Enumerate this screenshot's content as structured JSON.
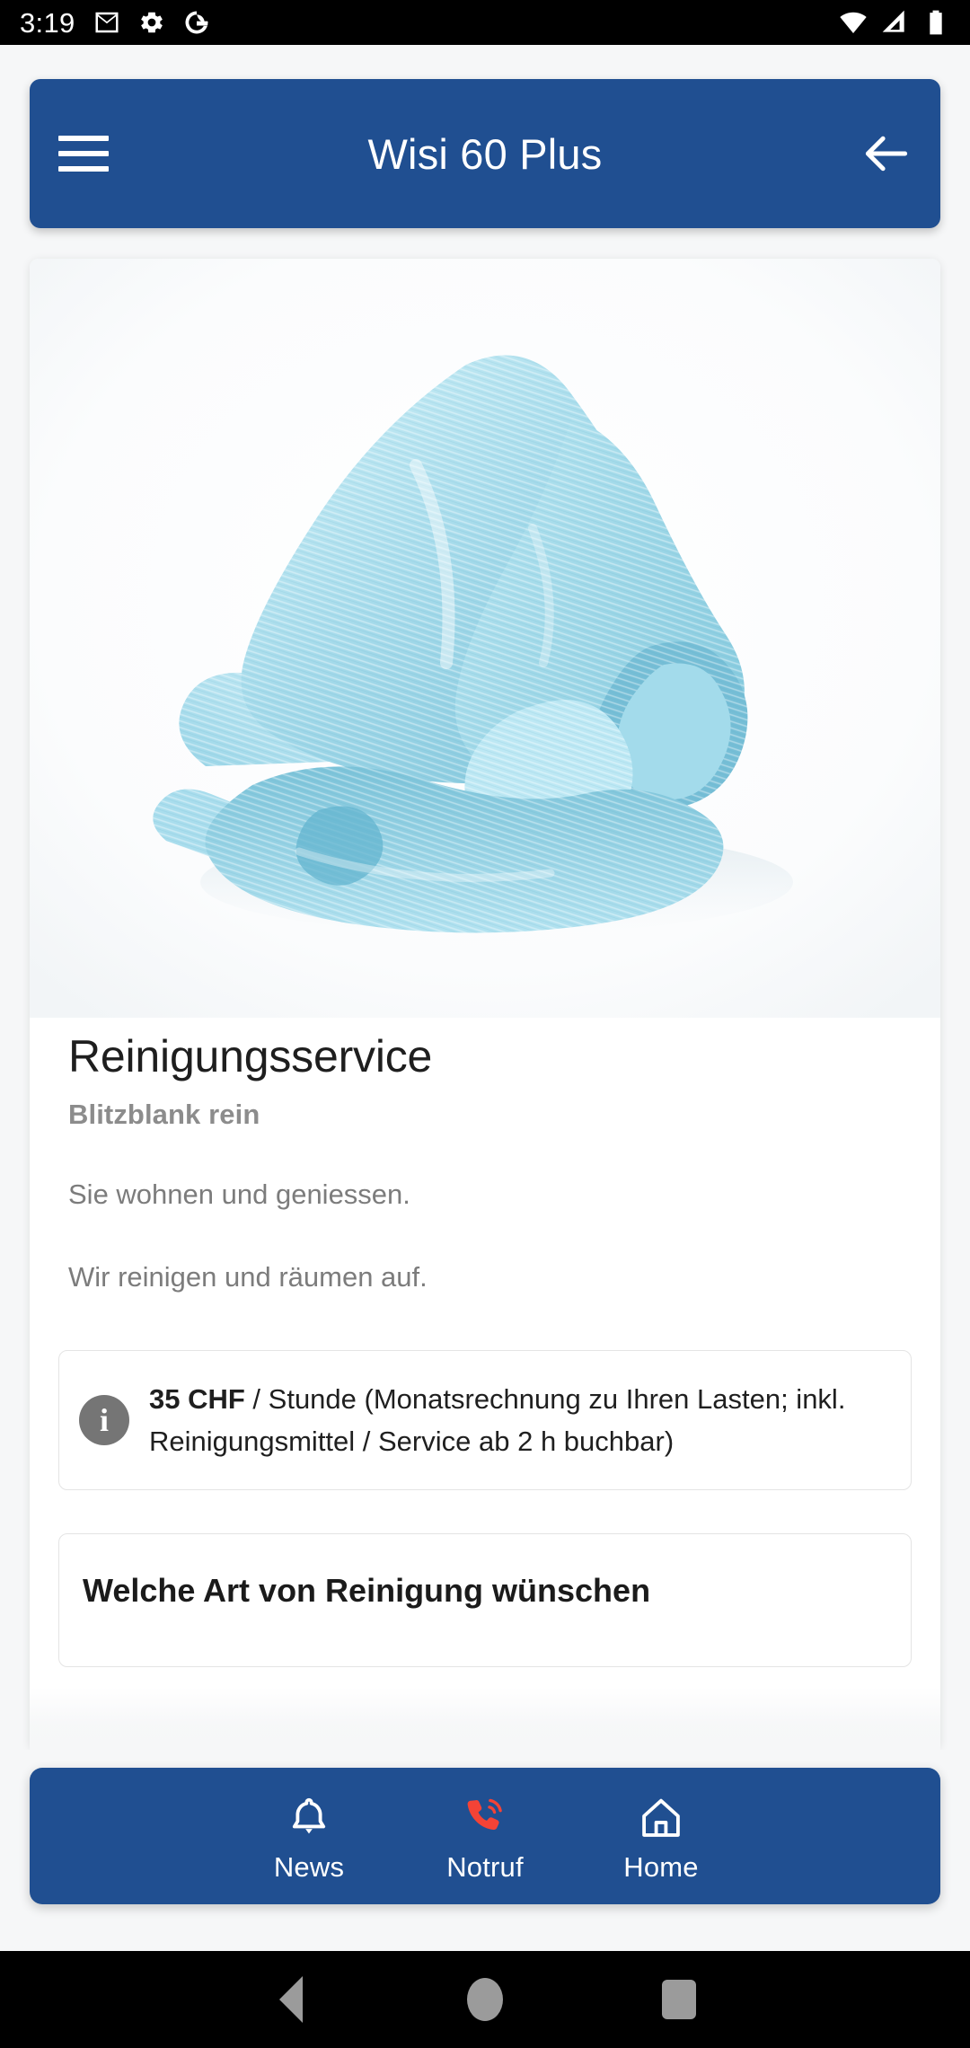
{
  "status_bar": {
    "time": "3:19",
    "icons_left": [
      "gmail-icon",
      "settings-gear-icon",
      "google-g-icon"
    ],
    "icons_right": [
      "wifi-icon",
      "cellular-signal-icon",
      "battery-icon"
    ]
  },
  "app_bar": {
    "menu_icon": "hamburger-menu-icon",
    "title": "Wisi 60 Plus",
    "back_icon": "arrow-left-icon",
    "background_color": "#204f91"
  },
  "hero": {
    "alt": "crumpled light blue microfibre cleaning cloth on white background",
    "cloth_color": "#a8dcec"
  },
  "detail": {
    "title": "Reinigungsservice",
    "subtitle": "Blitzblank rein",
    "paragraph_1": "Sie wohnen und geniessen.",
    "paragraph_2": "Wir reinigen und räumen auf.",
    "price_box": {
      "icon": "info-icon",
      "price": "35 CHF",
      "rest": " / Stunde (Monatsrechnung zu Ihren Lasten; inkl. Reinigungsmittel / Service ab 2 h buchbar)"
    },
    "next_card_heading": "Welche Art von Reinigung wünschen"
  },
  "bottom_nav": {
    "items": [
      {
        "label": "News",
        "icon": "bell-icon",
        "color": "#ffffff"
      },
      {
        "label": "Notruf",
        "icon": "phone-call-icon",
        "color": "#f44336"
      },
      {
        "label": "Home",
        "icon": "home-icon",
        "color": "#ffffff"
      }
    ]
  },
  "android_nav": {
    "back": "triangle-back-icon",
    "home": "circle-home-icon",
    "recents": "square-recents-icon",
    "color": "#9b9b9b"
  }
}
